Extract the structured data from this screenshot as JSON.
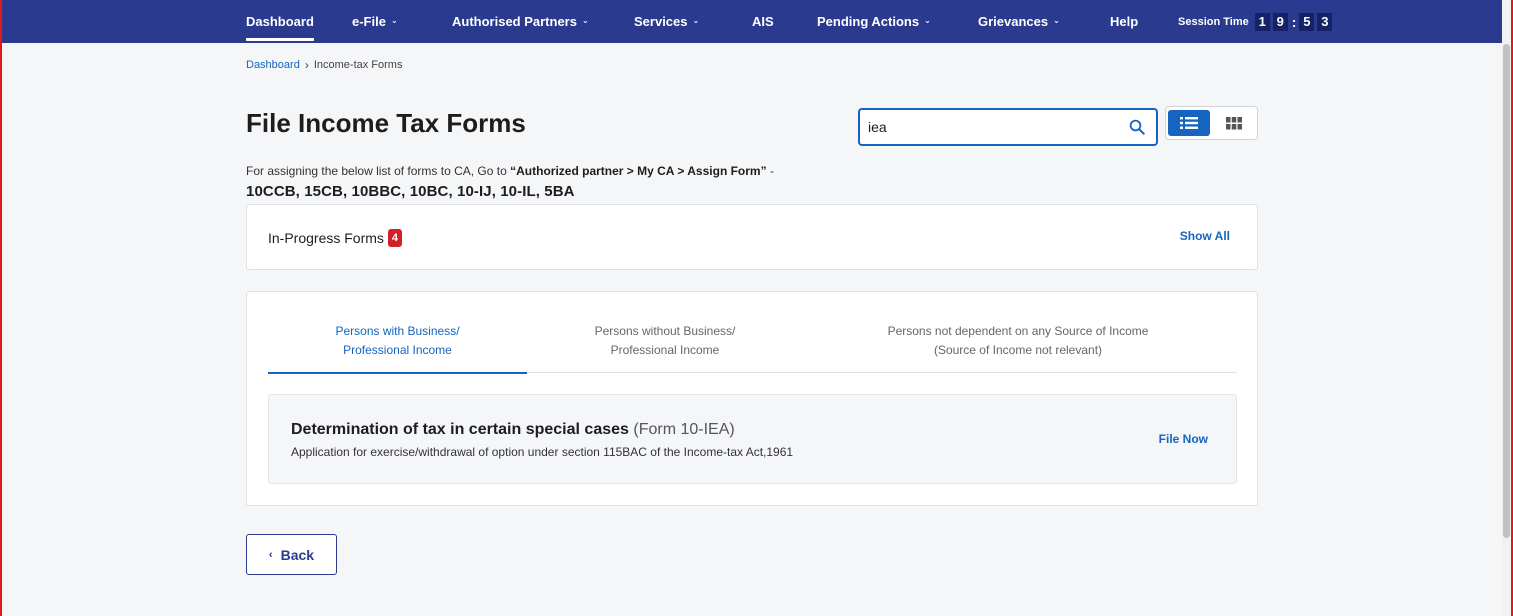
{
  "nav": {
    "items": [
      {
        "label": "Dashboard",
        "dropdown": false,
        "active": true
      },
      {
        "label": "e-File",
        "dropdown": true
      },
      {
        "label": "Authorised Partners",
        "dropdown": true
      },
      {
        "label": "Services",
        "dropdown": true
      },
      {
        "label": "AIS",
        "dropdown": false
      },
      {
        "label": "Pending Actions",
        "dropdown": true
      },
      {
        "label": "Grievances",
        "dropdown": true
      },
      {
        "label": "Help",
        "dropdown": false
      }
    ],
    "chevron": "⌄",
    "session_label": "Session Time",
    "session_digits": [
      "1",
      "9",
      "5",
      "3"
    ],
    "session_separator": ":"
  },
  "breadcrumb": {
    "home": "Dashboard",
    "separator": "›",
    "current": "Income-tax Forms"
  },
  "page_title": "File Income Tax Forms",
  "search": {
    "value": "iea",
    "placeholder": ""
  },
  "assign": {
    "prefix": "For assigning the below list of forms to CA, Go to ",
    "path": "“Authorized partner > My CA > Assign Form”",
    "suffix": " -",
    "forms": "10CCB, 15CB, 10BBC, 10BC, 10-IJ, 10-IL, 5BA"
  },
  "in_progress": {
    "label": "In-Progress Forms",
    "count": "4",
    "show_all": "Show All"
  },
  "tabs": [
    {
      "line1": "Persons with Business/",
      "line2": "Professional Income",
      "active": true
    },
    {
      "line1": "Persons without Business/",
      "line2": "Professional Income",
      "active": false
    },
    {
      "line1": "Persons not dependent on any Source of Income",
      "line2": "(Source of Income not relevant)",
      "active": false
    }
  ],
  "form": {
    "title": "Determination of tax in certain special cases",
    "code": "(Form 10-IEA)",
    "description": "Application for exercise/withdrawal of option under section 115BAC of the Income-tax Act,1961",
    "action": "File Now"
  },
  "back": {
    "chevron": "‹",
    "label": "Back"
  },
  "colors": {
    "nav_bg": "#2a3b8f",
    "accent": "#1565c0",
    "badge": "#d32027"
  }
}
